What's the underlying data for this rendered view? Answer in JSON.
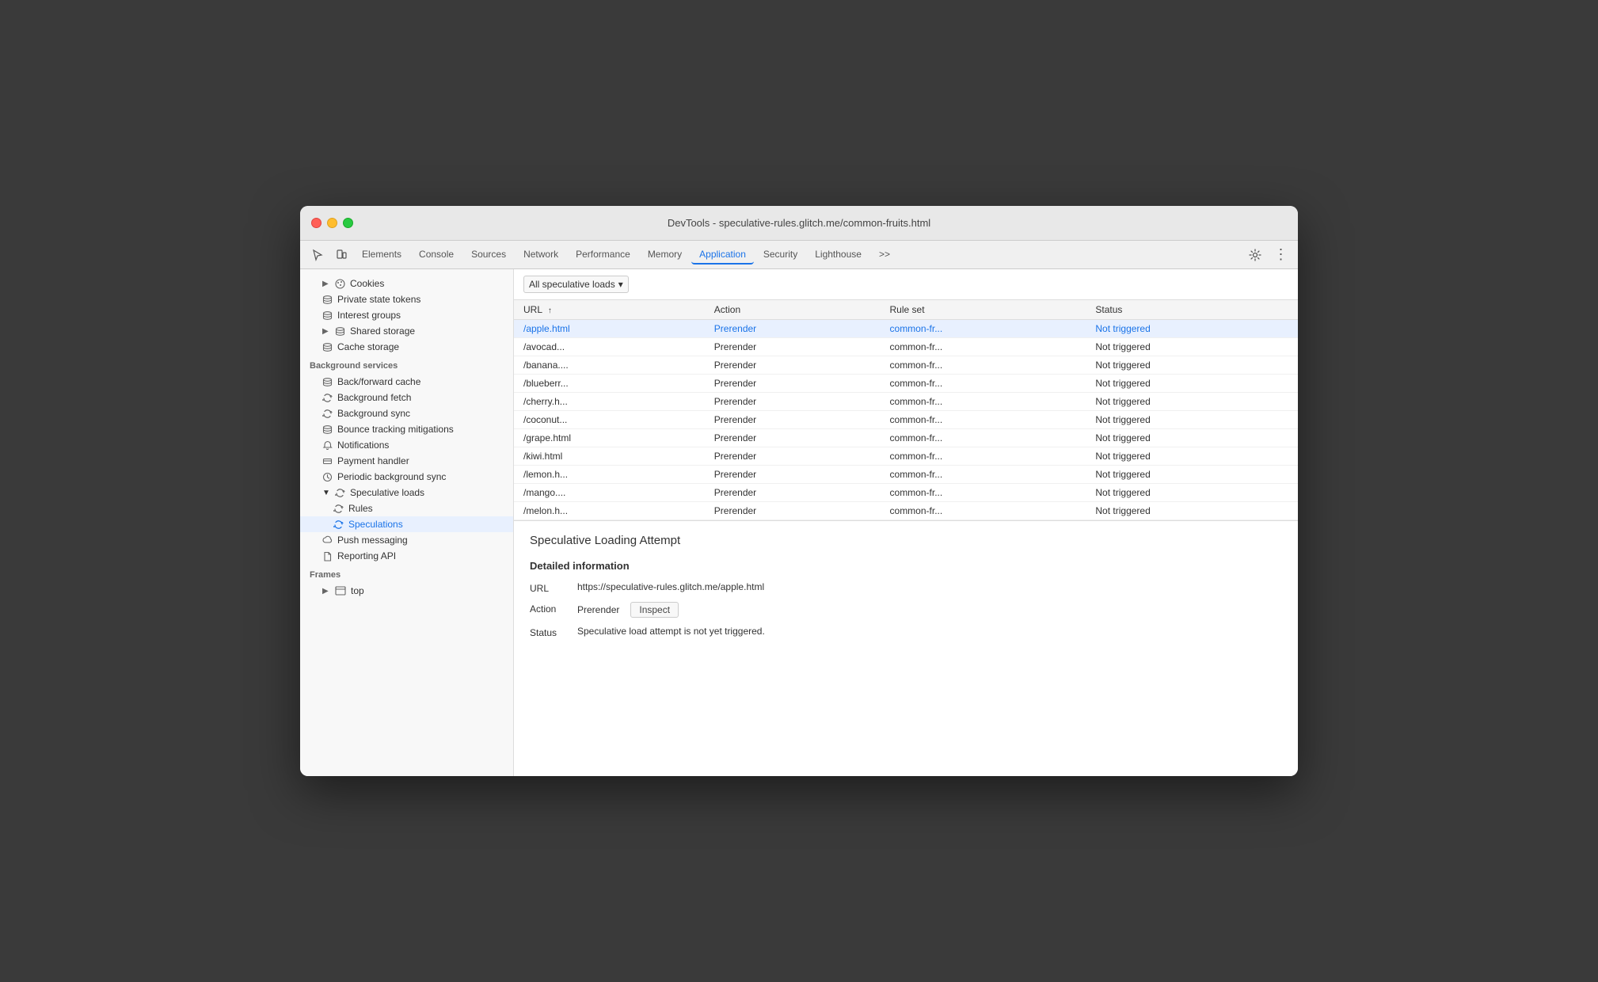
{
  "window": {
    "title": "DevTools - speculative-rules.glitch.me/common-fruits.html"
  },
  "tabs": {
    "items": [
      {
        "label": "Elements",
        "active": false
      },
      {
        "label": "Console",
        "active": false
      },
      {
        "label": "Sources",
        "active": false
      },
      {
        "label": "Network",
        "active": false
      },
      {
        "label": "Performance",
        "active": false
      },
      {
        "label": "Memory",
        "active": false
      },
      {
        "label": "Application",
        "active": true
      },
      {
        "label": "Security",
        "active": false
      },
      {
        "label": "Lighthouse",
        "active": false
      }
    ]
  },
  "sidebar": {
    "sections": [
      {
        "items": [
          {
            "label": "Cookies",
            "icon": "arrow-right",
            "indent": 1,
            "hasArrow": true
          },
          {
            "label": "Private state tokens",
            "icon": "db",
            "indent": 1
          },
          {
            "label": "Interest groups",
            "icon": "db",
            "indent": 1
          },
          {
            "label": "Shared storage",
            "icon": "db",
            "indent": 1,
            "hasArrow": true
          },
          {
            "label": "Cache storage",
            "icon": "db",
            "indent": 1
          }
        ]
      },
      {
        "header": "Background services",
        "items": [
          {
            "label": "Back/forward cache",
            "icon": "db",
            "indent": 1
          },
          {
            "label": "Background fetch",
            "icon": "sync",
            "indent": 1
          },
          {
            "label": "Background sync",
            "icon": "sync",
            "indent": 1
          },
          {
            "label": "Bounce tracking mitigations",
            "icon": "db",
            "indent": 1
          },
          {
            "label": "Notifications",
            "icon": "bell",
            "indent": 1
          },
          {
            "label": "Payment handler",
            "icon": "card",
            "indent": 1
          },
          {
            "label": "Periodic background sync",
            "icon": "clock",
            "indent": 1
          },
          {
            "label": "Speculative loads",
            "icon": "sync",
            "indent": 1,
            "hasArrow": true,
            "expanded": true
          },
          {
            "label": "Rules",
            "icon": "sync",
            "indent": 2
          },
          {
            "label": "Speculations",
            "icon": "sync",
            "indent": 2,
            "active": true
          },
          {
            "label": "Push messaging",
            "icon": "cloud",
            "indent": 1
          },
          {
            "label": "Reporting API",
            "icon": "file",
            "indent": 1
          }
        ]
      },
      {
        "header": "Frames",
        "items": [
          {
            "label": "top",
            "icon": "frame",
            "indent": 1,
            "hasArrow": true
          }
        ]
      }
    ]
  },
  "filter": {
    "label": "All speculative loads",
    "dropdown_icon": "▾"
  },
  "table": {
    "columns": [
      "URL",
      "Action",
      "Rule set",
      "Status"
    ],
    "rows": [
      {
        "url": "/apple.html",
        "action": "Prerender",
        "ruleset": "common-fr...",
        "status": "Not triggered",
        "selected": true
      },
      {
        "url": "/avocad...",
        "action": "Prerender",
        "ruleset": "common-fr...",
        "status": "Not triggered"
      },
      {
        "url": "/banana....",
        "action": "Prerender",
        "ruleset": "common-fr...",
        "status": "Not triggered"
      },
      {
        "url": "/blueberr...",
        "action": "Prerender",
        "ruleset": "common-fr...",
        "status": "Not triggered"
      },
      {
        "url": "/cherry.h...",
        "action": "Prerender",
        "ruleset": "common-fr...",
        "status": "Not triggered"
      },
      {
        "url": "/coconut...",
        "action": "Prerender",
        "ruleset": "common-fr...",
        "status": "Not triggered"
      },
      {
        "url": "/grape.html",
        "action": "Prerender",
        "ruleset": "common-fr...",
        "status": "Not triggered"
      },
      {
        "url": "/kiwi.html",
        "action": "Prerender",
        "ruleset": "common-fr...",
        "status": "Not triggered"
      },
      {
        "url": "/lemon.h...",
        "action": "Prerender",
        "ruleset": "common-fr...",
        "status": "Not triggered"
      },
      {
        "url": "/mango....",
        "action": "Prerender",
        "ruleset": "common-fr...",
        "status": "Not triggered"
      },
      {
        "url": "/melon.h...",
        "action": "Prerender",
        "ruleset": "common-fr...",
        "status": "Not triggered"
      }
    ]
  },
  "detail": {
    "title": "Speculative Loading Attempt",
    "section_title": "Detailed information",
    "url_label": "URL",
    "url_value": "https://speculative-rules.glitch.me/apple.html",
    "action_label": "Action",
    "action_value": "Prerender",
    "inspect_label": "Inspect",
    "status_label": "Status",
    "status_value": "Speculative load attempt is not yet triggered."
  },
  "icons": {
    "cursor": "⬚",
    "device": "⬚",
    "settings": "⚙",
    "more": "⋮",
    "more_tabs": ">>"
  }
}
